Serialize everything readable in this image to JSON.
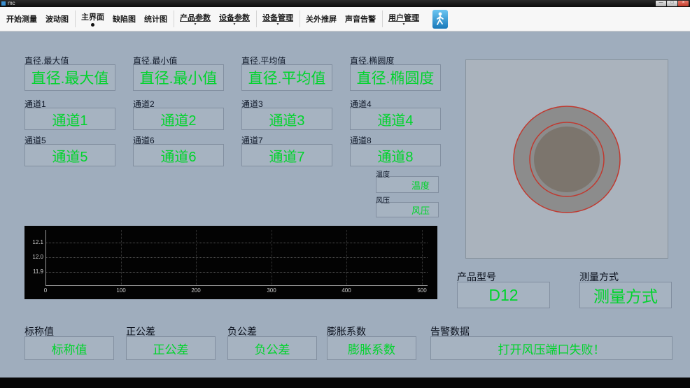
{
  "window": {
    "title": "mc",
    "minimize": "—",
    "maximize": "□",
    "close": "×"
  },
  "toolbar": {
    "buttons": [
      {
        "label": "开始测量"
      },
      {
        "label": "波动图"
      },
      {
        "label": "主界面"
      },
      {
        "label": "缺陷图"
      },
      {
        "label": "统计图"
      },
      {
        "label": "产品参数"
      },
      {
        "label": "设备参数"
      },
      {
        "label": "设备管理"
      },
      {
        "label": "关外推屏"
      },
      {
        "label": "声音告警"
      },
      {
        "label": "用户管理"
      }
    ]
  },
  "readouts": {
    "row1": [
      {
        "label": "直径.最大值",
        "value": "直径.最大值"
      },
      {
        "label": "直径.最小值",
        "value": "直径.最小值"
      },
      {
        "label": "直径.平均值",
        "value": "直径.平均值"
      },
      {
        "label": "直径.椭圆度",
        "value": "直径.椭圆度"
      }
    ],
    "row2": [
      {
        "label": "通道1",
        "value": "通道1"
      },
      {
        "label": "通道2",
        "value": "通道2"
      },
      {
        "label": "通道3",
        "value": "通道3"
      },
      {
        "label": "通道4",
        "value": "通道4"
      }
    ],
    "row3": [
      {
        "label": "通道5",
        "value": "通道5"
      },
      {
        "label": "通道6",
        "value": "通道6"
      },
      {
        "label": "通道7",
        "value": "通道7"
      },
      {
        "label": "通道8",
        "value": "通道8"
      }
    ],
    "temperature": {
      "label": "温度",
      "value": "温度"
    },
    "pressure": {
      "label": "风压",
      "value": "风压"
    }
  },
  "chart_data": {
    "type": "line",
    "title": "",
    "xlabel": "",
    "ylabel": "",
    "xtick_labels": [
      "0",
      "100",
      "200",
      "300",
      "400",
      "500"
    ],
    "ytick_labels": [
      "12.1",
      "12.0",
      "11.9"
    ],
    "xlim": [
      0,
      500
    ],
    "ylim": [
      11.9,
      12.1
    ],
    "grid": true,
    "legend": false,
    "series": []
  },
  "cross_section": {
    "outer_circle_color": "#8c8c8c",
    "inner_circle_color": "#7c756d",
    "ring_color": "#c0392f"
  },
  "product": {
    "model_label": "产品型号",
    "model_value": "D12",
    "method_label": "测量方式",
    "method_value": "测量方式"
  },
  "bottom": {
    "nominal": {
      "label": "标称值",
      "value": "标称值"
    },
    "pos_tol": {
      "label": "正公差",
      "value": "正公差"
    },
    "neg_tol": {
      "label": "负公差",
      "value": "负公差"
    },
    "expansion": {
      "label": "膨胀系数",
      "value": "膨胀系数"
    },
    "alarm": {
      "label": "告警数据",
      "value": "打开风压端口失败！"
    }
  },
  "colors": {
    "accent_green": "#00d42c",
    "main_bg": "#9fadbd",
    "chart_bg": "#030303"
  }
}
